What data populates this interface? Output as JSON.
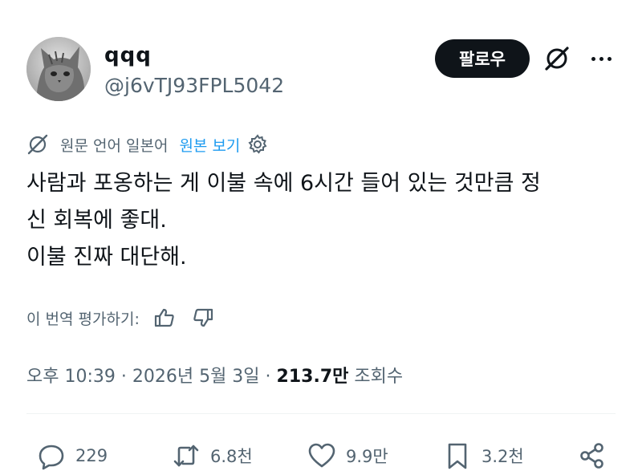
{
  "author": {
    "display_name": "qqq",
    "handle": "@j6vTJ93FPL5042",
    "avatar_icon": "cat-avatar"
  },
  "header_actions": {
    "follow_label": "팔로우",
    "grok_icon": "grok-icon",
    "more_icon": "more-dots-icon"
  },
  "translation": {
    "icon": "globe-icon",
    "source_language": "원문 언어 일본어",
    "show_original": "원본 보기",
    "settings_icon": "gear-icon"
  },
  "tweet": {
    "lines": [
      "사람과 포옹하는 게 이불 속에 6시간 들어 있는 것만큼 정",
      "신 회복에 좋대.",
      "이불 진짜 대단해."
    ]
  },
  "rate_translation": {
    "label": "이 번역 평가하기:",
    "thumbs_up_icon": "thumbs-up-icon",
    "thumbs_down_icon": "thumbs-down-icon"
  },
  "meta": {
    "time": "오후 10:39",
    "separator": " · ",
    "date": "2026년 5월 3일",
    "views_count": "213.7만",
    "views_label": "조회수"
  },
  "actions": {
    "replies": "229",
    "reposts": "6.8천",
    "likes": "9.9만",
    "bookmarks": "3.2천"
  },
  "colors": {
    "text": "#0f1419",
    "secondary": "#536471",
    "link": "#1d9bf0",
    "follow_bg": "#0f1419"
  }
}
